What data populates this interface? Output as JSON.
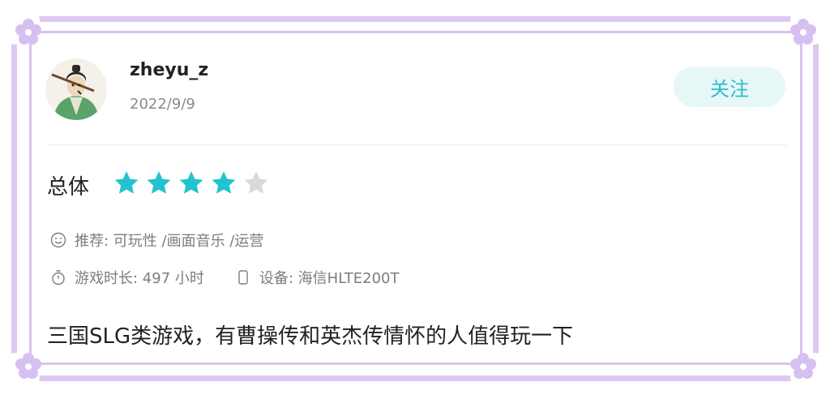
{
  "user": {
    "name": "zheyu_z",
    "date": "2022/9/9",
    "follow_label": "关注"
  },
  "rating": {
    "label": "总体",
    "score": 4,
    "max": 5,
    "star_color": "#22c3cf",
    "empty_star_color": "#d6dadd"
  },
  "meta": {
    "recommend": "推荐: 可玩性 /画面音乐 /运营",
    "playtime": "游戏时长:  497 小时",
    "device": "设备:  海信HLTE200T"
  },
  "review": {
    "text": "三国SLG类游戏，有曹操传和英杰传情怀的人值得玩一下"
  },
  "colors": {
    "frame": "#dcc8f3",
    "accent": "#2bbfcb",
    "follow_bg": "#e6f7f8"
  }
}
